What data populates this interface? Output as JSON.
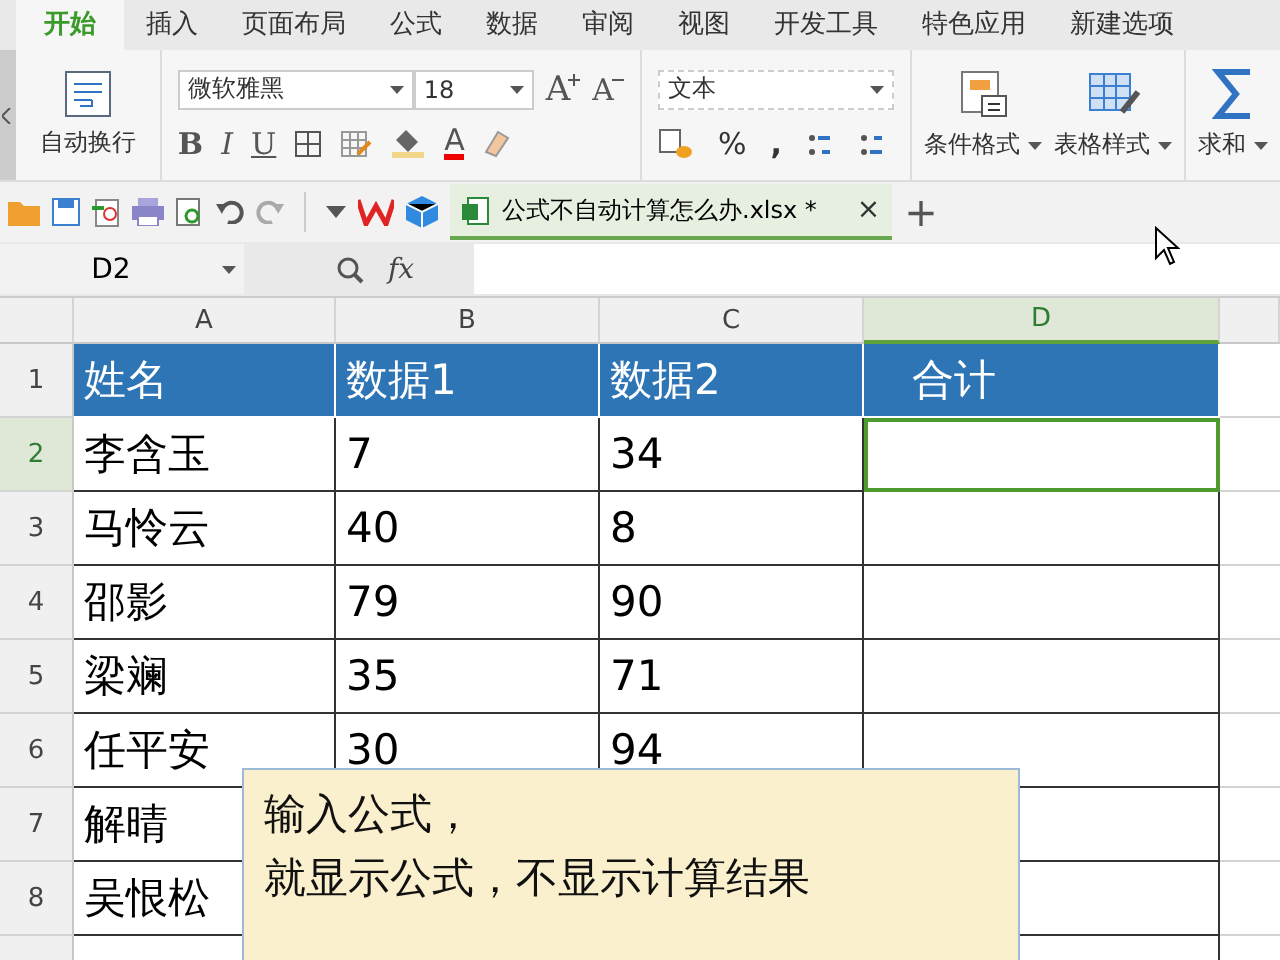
{
  "tabs": [
    {
      "label": "开始",
      "selected": true
    },
    {
      "label": "插入",
      "selected": false
    },
    {
      "label": "页面布局",
      "selected": false
    },
    {
      "label": "公式",
      "selected": false
    },
    {
      "label": "数据",
      "selected": false
    },
    {
      "label": "审阅",
      "selected": false
    },
    {
      "label": "视图",
      "selected": false
    },
    {
      "label": "开发工具",
      "selected": false
    },
    {
      "label": "特色应用",
      "selected": false
    },
    {
      "label": "新建选项",
      "selected": false
    }
  ],
  "ribbon": {
    "wrap_text": "自动换行",
    "font_name": "微软雅黑",
    "font_size": "18",
    "grow_font": "A",
    "shrink_font": "A",
    "bold": "B",
    "italic": "I",
    "underline": "U",
    "font_color": "A",
    "number_format": "文本",
    "percent": "%",
    "comma": ",",
    "conditional_format": "条件格式",
    "table_style": "表格样式",
    "sum": "求和"
  },
  "document_tab": {
    "title": "公式不自动计算怎么办.xlsx *",
    "close": "×",
    "new_tab": "+"
  },
  "formula_bar": {
    "name_box": "D2",
    "fx": "fx"
  },
  "columns": [
    {
      "label": "A",
      "selected": false
    },
    {
      "label": "B",
      "selected": false
    },
    {
      "label": "C",
      "selected": false
    },
    {
      "label": "D",
      "selected": true
    }
  ],
  "rows": [
    {
      "number": "1",
      "kind": "header",
      "selected": false,
      "cells": [
        "姓名",
        "数据1",
        "数据2",
        "合计"
      ]
    },
    {
      "number": "2",
      "kind": "data",
      "selected": true,
      "cells": [
        "李含玉",
        "7",
        "34"
      ]
    },
    {
      "number": "3",
      "kind": "data",
      "selected": false,
      "cells": [
        "马怜云",
        "40",
        "8"
      ]
    },
    {
      "number": "4",
      "kind": "data",
      "selected": false,
      "cells": [
        "邵影",
        "79",
        "90"
      ]
    },
    {
      "number": "5",
      "kind": "data",
      "selected": false,
      "cells": [
        "梁斓",
        "35",
        "71"
      ]
    },
    {
      "number": "6",
      "kind": "data",
      "selected": false,
      "cells": [
        "任平安",
        "30",
        "94"
      ]
    },
    {
      "number": "7",
      "kind": "data",
      "selected": false,
      "cells": [
        "解晴"
      ]
    },
    {
      "number": "8",
      "kind": "data",
      "selected": false,
      "cells": [
        "吴恨松"
      ]
    }
  ],
  "note": {
    "lines": [
      "输入公式，",
      "就显示公式，不显示计算结果"
    ]
  }
}
